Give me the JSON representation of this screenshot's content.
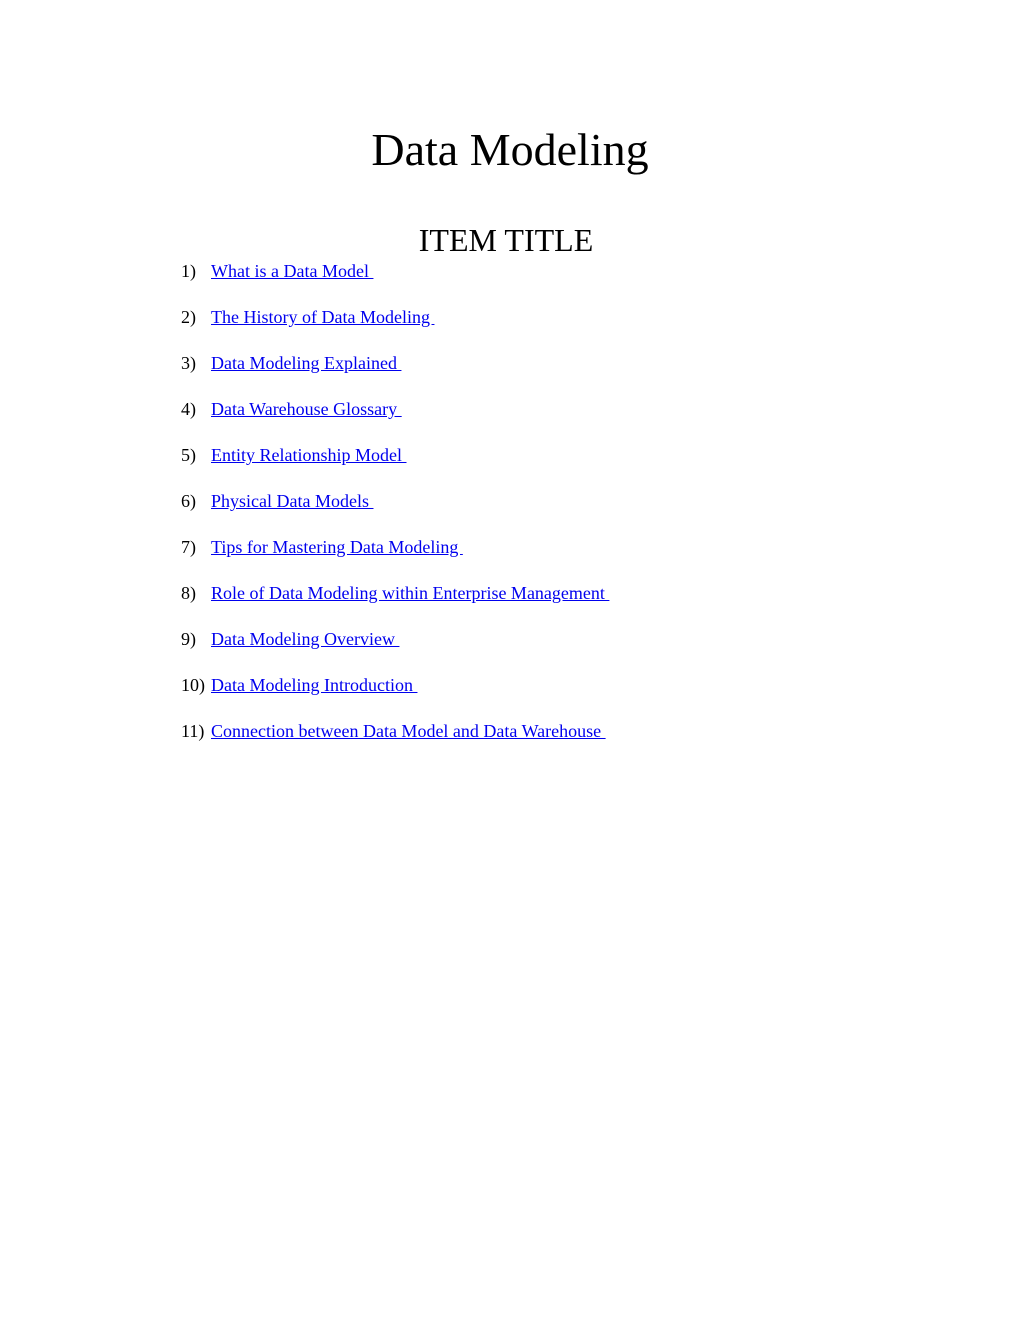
{
  "document": {
    "title": "Data Modeling",
    "subtitle": "ITEM TITLE",
    "items": [
      {
        "number": "1)",
        "label": "What is a Data Model "
      },
      {
        "number": "2)",
        "label": "The History of Data Modeling "
      },
      {
        "number": "3)",
        "label": "Data Modeling Explained "
      },
      {
        "number": "4)",
        "label": "Data Warehouse Glossary "
      },
      {
        "number": "5)",
        "label": "Entity Relationship Model "
      },
      {
        "number": "6)",
        "label": "Physical Data Models "
      },
      {
        "number": "7)",
        "label": "Tips for Mastering Data Modeling "
      },
      {
        "number": "8)",
        "label": "Role of Data Modeling within Enterprise Management "
      },
      {
        "number": "9)",
        "label": "Data Modeling Overview "
      },
      {
        "number": "10)",
        "label": "Data Modeling Introduction "
      },
      {
        "number": "11)",
        "label": "Connection between Data Model and Data Warehouse "
      }
    ],
    "link_color": "#0000ee"
  }
}
